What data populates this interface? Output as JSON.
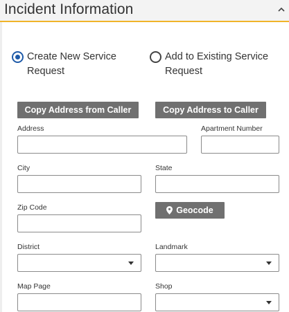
{
  "header": {
    "title": "Incident Information",
    "collapse_icon": "chevron-up-icon"
  },
  "request_type": {
    "options": [
      {
        "label_line1": "Create New Service",
        "label_line2": "Request",
        "checked": true
      },
      {
        "label_line1": "Add to Existing Service",
        "label_line2": "Request",
        "checked": false
      }
    ]
  },
  "buttons": {
    "copy_from_caller": "Copy Address from Caller",
    "copy_to_caller": "Copy Address to Caller",
    "geocode": "Geocode",
    "geocode_icon": "map-pin-icon"
  },
  "fields": {
    "address": {
      "label": "Address",
      "value": ""
    },
    "apartment": {
      "label": "Apartment Number",
      "value": ""
    },
    "city": {
      "label": "City",
      "value": ""
    },
    "state": {
      "label": "State",
      "value": ""
    },
    "zip": {
      "label": "Zip Code",
      "value": ""
    },
    "district": {
      "label": "District",
      "value": ""
    },
    "landmark": {
      "label": "Landmark",
      "value": ""
    },
    "map_page": {
      "label": "Map Page",
      "value": ""
    },
    "shop": {
      "label": "Shop",
      "value": ""
    }
  },
  "colors": {
    "accent_border": "#f0b429",
    "radio_selected": "#1e5aa8",
    "button_bg": "#707070"
  }
}
